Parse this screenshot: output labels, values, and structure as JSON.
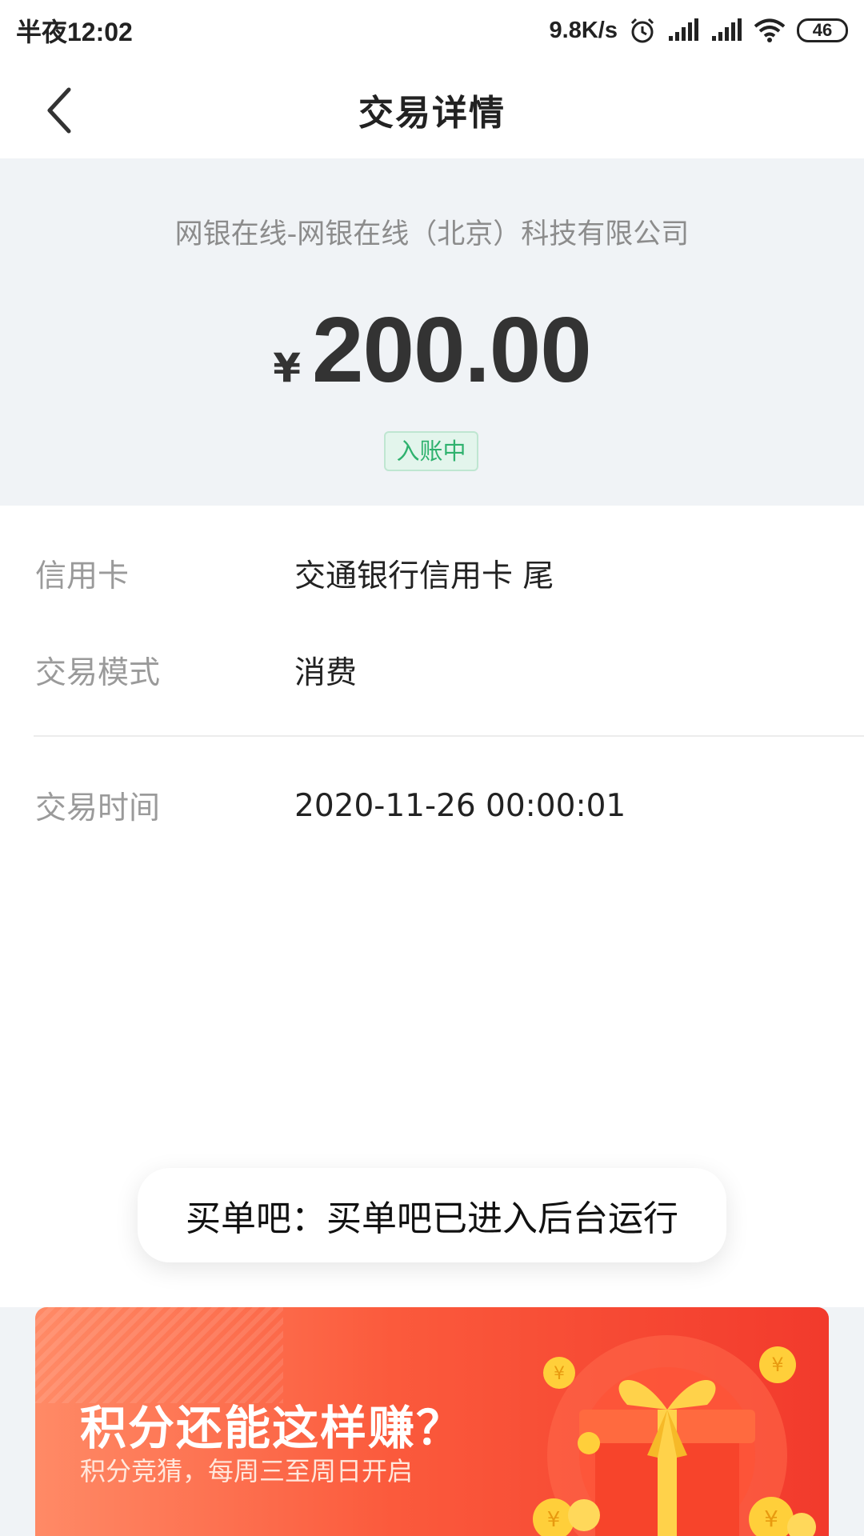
{
  "status_bar": {
    "time": "半夜12:02",
    "net_speed": "9.8K/s",
    "battery": "46"
  },
  "header": {
    "title": "交易详情"
  },
  "summary": {
    "merchant": "网银在线-网银在线（北京）科技有限公司",
    "currency": "¥",
    "amount": "200.00",
    "status": "入账中"
  },
  "details": [
    {
      "label": "信用卡",
      "value": "交通银行信用卡 尾"
    },
    {
      "label": "交易模式",
      "value": "消费"
    },
    {
      "label": "交易时间",
      "value": "2020-11-26 00:00:01"
    }
  ],
  "toast": {
    "text": "买单吧：买单吧已进入后台运行"
  },
  "promo": {
    "title": "积分还能这样赚？",
    "subtitle": "积分竞猜，每周三至周日开启"
  },
  "colors": {
    "status_green": "#2fb26e",
    "summary_bg": "#f0f3f6",
    "promo_red": "#f23a2c",
    "promo_orange": "#ff8a66"
  }
}
